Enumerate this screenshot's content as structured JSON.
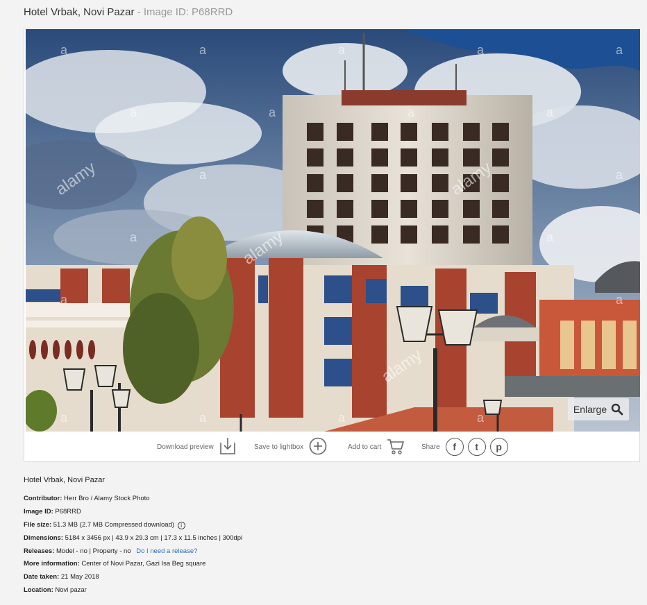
{
  "header": {
    "title": "Hotel Vrbak, Novi Pazar",
    "separator": "-",
    "image_id_label": "Image ID: P68RRD"
  },
  "photo": {
    "alt": "Hotel Vrbak, Novi Pazar",
    "watermark": "alamy",
    "watermark_small": "a",
    "enlarge_label": "Enlarge"
  },
  "actions": {
    "download_preview": "Download preview",
    "save_to_lightbox": "Save to lightbox",
    "add_to_cart": "Add to cart",
    "share": "Share",
    "share_facebook_icon": "f",
    "share_twitter_icon": "t",
    "share_pinterest_icon": "p"
  },
  "details": {
    "caption": "Hotel Vrbak, Novi Pazar",
    "contributor_label": "Contributor:",
    "contributor_value": "Herr Bro / Alamy Stock Photo",
    "image_id_label": "Image ID:",
    "image_id_value": "P68RRD",
    "file_size_label": "File size:",
    "file_size_value": "51.3 MB (2.7 MB Compressed download)",
    "dimensions_label": "Dimensions:",
    "dimensions_value": "5184 x 3456 px | 43.9 x 29.3 cm | 17.3 x 11.5 inches | 300dpi",
    "releases_label": "Releases:",
    "releases_value": "Model - no | Property - no",
    "releases_link": "Do I need a release?",
    "more_info_label": "More information:",
    "more_info_value": "Center of Novi Pazar, Gazi Isa Beg square",
    "date_taken_label": "Date taken:",
    "date_taken_value": "21 May 2018",
    "location_label": "Location:",
    "location_value": "Novi pazar"
  }
}
